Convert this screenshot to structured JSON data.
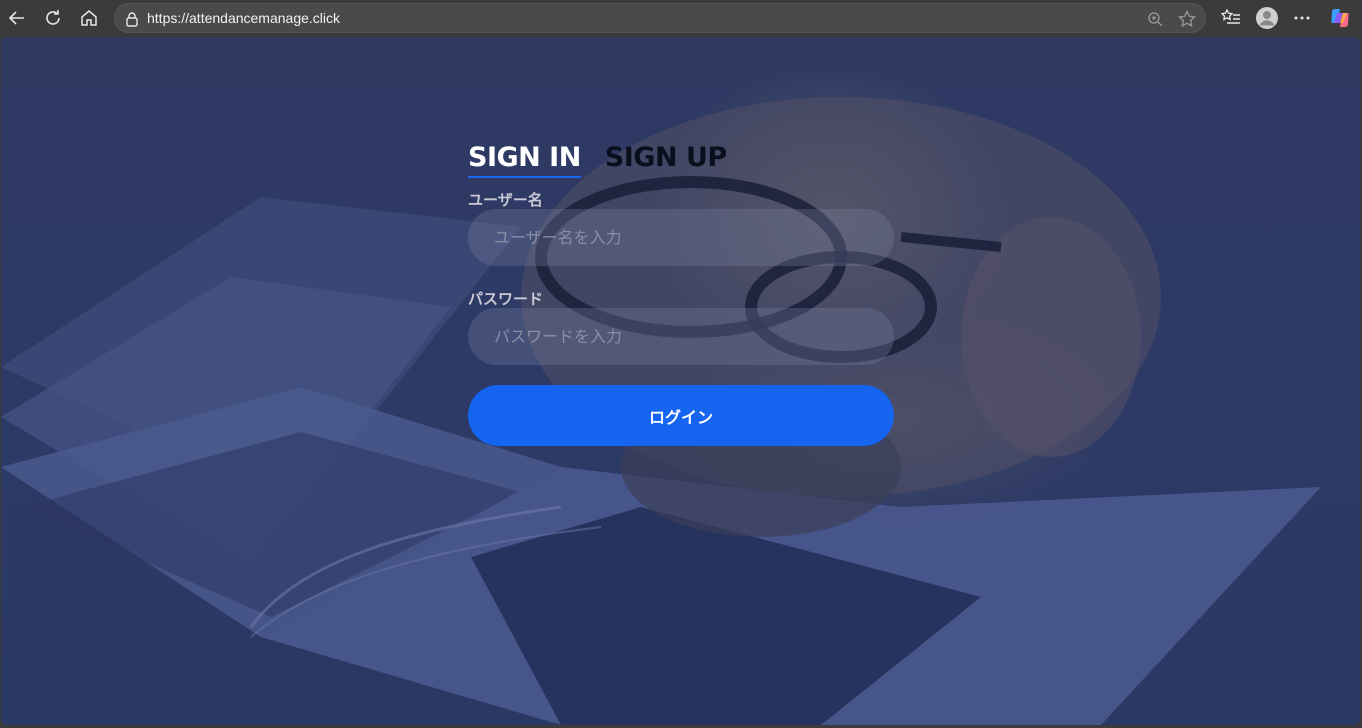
{
  "browser": {
    "url": "https://attendancemanage.click"
  },
  "auth": {
    "tabs": [
      {
        "label": "SIGN IN",
        "active": true
      },
      {
        "label": "SIGN UP",
        "active": false
      }
    ],
    "username": {
      "label": "ユーザー名",
      "placeholder": "ユーザー名を入力",
      "value": ""
    },
    "password": {
      "label": "パスワード",
      "placeholder": "パスワードを入力",
      "value": ""
    },
    "submit_label": "ログイン"
  },
  "colors": {
    "accent": "#1565f0",
    "overlay": "#2d3a66"
  }
}
